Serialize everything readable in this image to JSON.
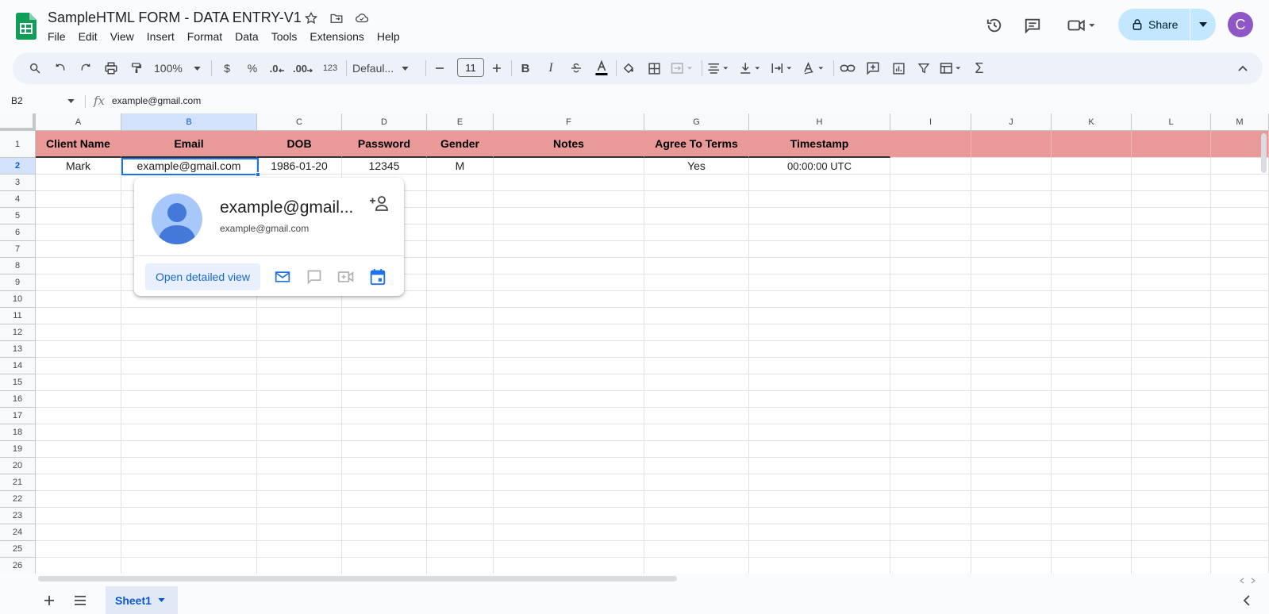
{
  "app": {
    "doc_title": "SampleHTML FORM - DATA ENTRY-V1",
    "menu": [
      "File",
      "Edit",
      "View",
      "Insert",
      "Format",
      "Data",
      "Tools",
      "Extensions",
      "Help"
    ],
    "share_label": "Share",
    "avatar_letter": "C"
  },
  "toolbar": {
    "zoom": "100%",
    "currency": "$",
    "percent": "%",
    "dec_decrease": ".0",
    "dec_increase": ".00",
    "format_num": "123",
    "font": "Defaul...",
    "font_size": "11",
    "bold": "B",
    "italic": "I",
    "sigma": "Σ"
  },
  "formula_bar": {
    "cell_ref": "B2",
    "fx": "fx",
    "value": "example@gmail.com"
  },
  "sheet": {
    "columns": [
      "A",
      "B",
      "C",
      "D",
      "E",
      "F",
      "G",
      "H",
      "I",
      "J",
      "K",
      "L",
      "M"
    ],
    "rows": [
      "1",
      "2",
      "3",
      "4",
      "5",
      "6",
      "7",
      "8",
      "9",
      "10",
      "11",
      "12",
      "13",
      "14",
      "15",
      "16",
      "17",
      "18",
      "19",
      "20",
      "21",
      "22",
      "23",
      "24",
      "25",
      "26"
    ],
    "header_row": [
      "Client Name",
      "Email",
      "DOB",
      "Password",
      "Gender",
      "Notes",
      "Agree To Terms",
      "Timestamp"
    ],
    "data_row": [
      "Mark",
      "example@gmail.com",
      "1986-01-20",
      "12345",
      "M",
      "",
      "Yes",
      "00:00:00 UTC"
    ]
  },
  "popup": {
    "name": "example@gmail...",
    "email": "example@gmail.com",
    "open_label": "Open detailed view"
  },
  "tabs": {
    "sheet1": "Sheet1"
  },
  "colors": {
    "header_fill": "#ea9999",
    "accent": "#1a73e8",
    "share_bg": "#c2e7ff",
    "avatar_bg": "#8e56c6"
  }
}
